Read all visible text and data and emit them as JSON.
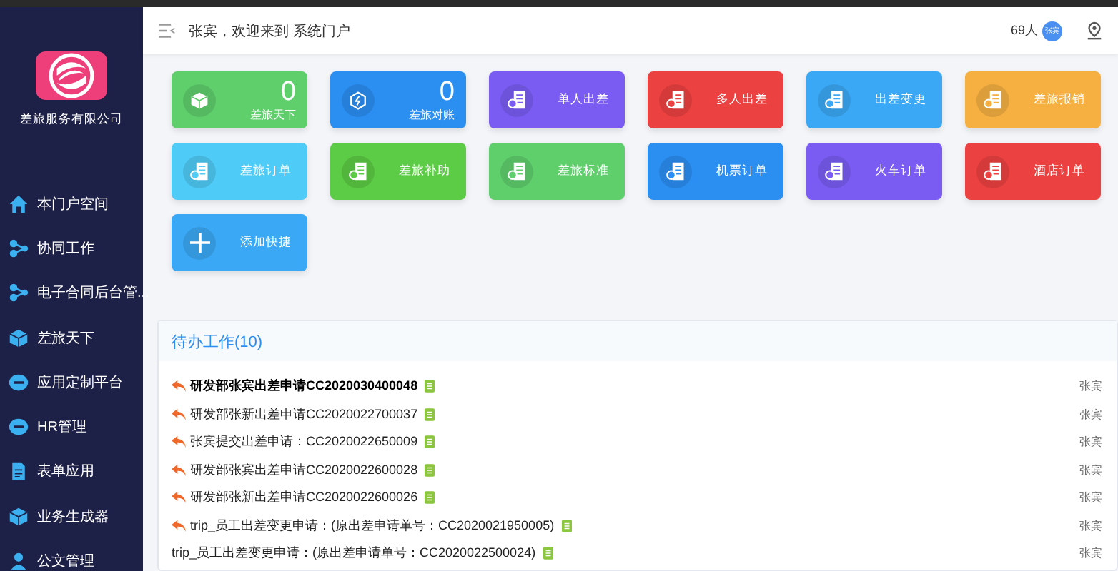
{
  "sidebar": {
    "company": "差旅服务有限公司",
    "items": [
      {
        "label": "本门户空间"
      },
      {
        "label": "协同工作"
      },
      {
        "label": "电子合同后台管..."
      },
      {
        "label": "差旅天下"
      },
      {
        "label": "应用定制平台"
      },
      {
        "label": "HR管理"
      },
      {
        "label": "表单应用"
      },
      {
        "label": "业务生成器"
      },
      {
        "label": "公文管理"
      }
    ]
  },
  "header": {
    "greeting": "张宾，欢迎来到 系统门户",
    "online": "69人",
    "avatar": "张宾"
  },
  "tiles": [
    {
      "kind": "counter",
      "label": "差旅天下",
      "count": "0",
      "color": "#5fcf6c"
    },
    {
      "kind": "counter",
      "label": "差旅对账",
      "count": "0",
      "color": "#2b8ef1"
    },
    {
      "kind": "action",
      "label": "单人出差",
      "color": "#7a5cf3"
    },
    {
      "kind": "action",
      "label": "多人出差",
      "color": "#ec4141"
    },
    {
      "kind": "action",
      "label": "出差变更",
      "color": "#3aa8f4"
    },
    {
      "kind": "action",
      "label": "差旅报销",
      "color": "#f5b041"
    },
    {
      "kind": "action",
      "label": "差旅订单",
      "color": "#4fcbf7"
    },
    {
      "kind": "action",
      "label": "差旅补助",
      "color": "#5ccb45"
    },
    {
      "kind": "action",
      "label": "差旅标准",
      "color": "#5fcf6c"
    },
    {
      "kind": "action",
      "label": "机票订单",
      "color": "#2b8ef1"
    },
    {
      "kind": "action",
      "label": "火车订单",
      "color": "#7a5cf3"
    },
    {
      "kind": "action",
      "label": "酒店订单",
      "color": "#ec4141"
    },
    {
      "kind": "add",
      "label": "添加快捷",
      "color": "#3aa8f4"
    }
  ],
  "todo": {
    "title": "待办工作(10)",
    "items": [
      {
        "text": "研发部张宾出差申请CC2020030400048",
        "user": "张宾",
        "returned": true,
        "unread": true
      },
      {
        "text": "研发部张新出差申请CC2020022700037",
        "user": "张宾",
        "returned": true,
        "unread": false
      },
      {
        "text": "张宾提交出差申请：CC2020022650009",
        "user": "张宾",
        "returned": true,
        "unread": false
      },
      {
        "text": "研发部张宾出差申请CC2020022600028",
        "user": "张宾",
        "returned": true,
        "unread": false
      },
      {
        "text": "研发部张新出差申请CC2020022600026",
        "user": "张宾",
        "returned": true,
        "unread": false
      },
      {
        "text": "trip_员工出差变更申请：(原出差申请单号：CC2020021950005)",
        "user": "张宾",
        "returned": true,
        "unread": false
      },
      {
        "text": "trip_员工出差变更申请：(原出差申请单号：CC2020022500024)",
        "user": "张宾",
        "returned": false,
        "unread": false
      }
    ]
  }
}
